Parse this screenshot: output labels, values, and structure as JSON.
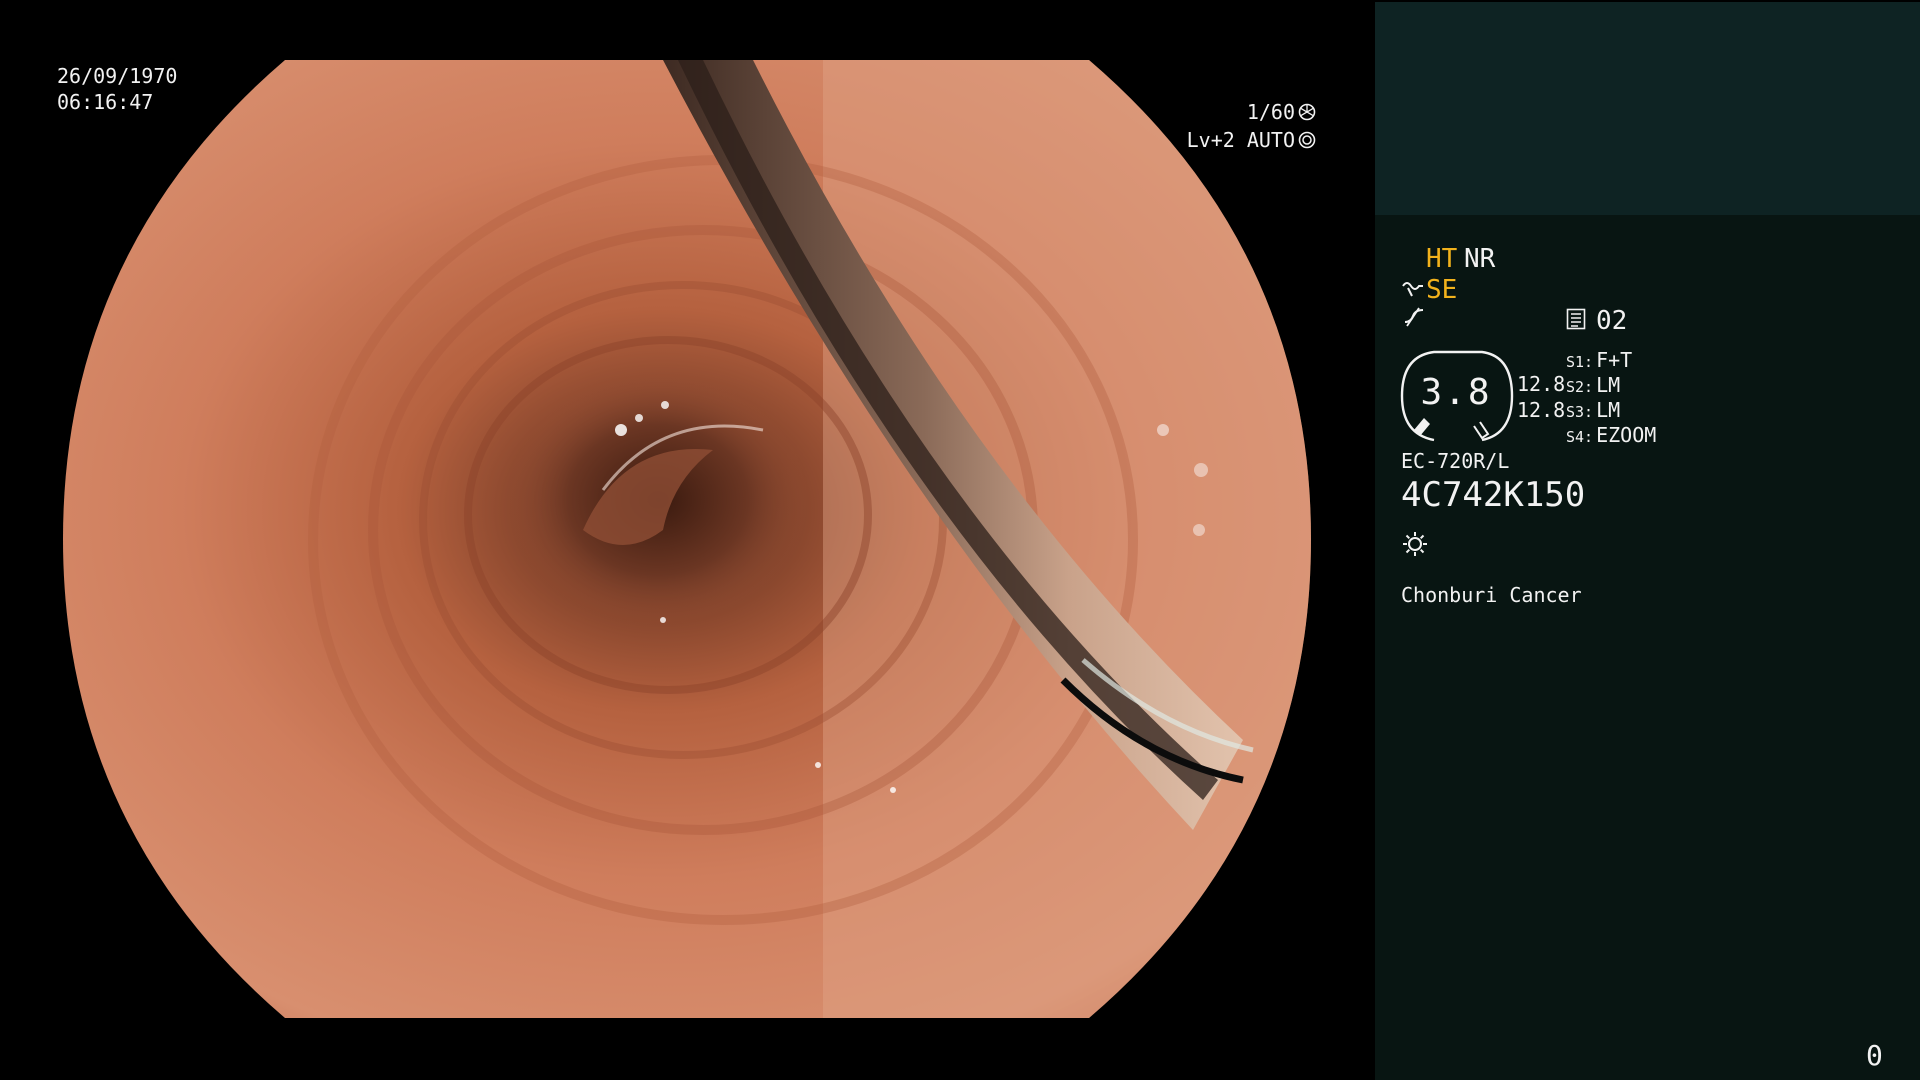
{
  "video": {
    "date": "26/09/1970",
    "time": "06:16:47",
    "shutter": "1/60",
    "iris": "Lv+2 AUTO",
    "shutter_icon": "shutter-icon",
    "iris_icon": "iris-icon"
  },
  "panel": {
    "modes": {
      "ht": "HT",
      "nr": "NR",
      "se": "SE",
      "se_icon": "structure-enhance-icon",
      "curve_icon": "tone-curve-icon"
    },
    "memory": {
      "icon": "memory-icon",
      "number": "02"
    },
    "zoom": {
      "value": "3.8",
      "ratio_top": "12.8",
      "ratio_bottom": "12.8"
    },
    "switches": [
      {
        "key": "S1:",
        "value": "F+T"
      },
      {
        "key": "S2:",
        "value": "LM"
      },
      {
        "key": "S3:",
        "value": "LM"
      },
      {
        "key": "S4:",
        "value": "EZOOM"
      }
    ],
    "scope_model": "EC-720R/L",
    "scope_serial": "4C742K150",
    "light_icon": "light-source-icon",
    "institution": "Chonburi Cancer",
    "counter": "0"
  },
  "colors": {
    "panel_top": "#0e2323",
    "panel_bg": "#081512",
    "accent_yellow": "#f2b21c",
    "text": "#f2f2f2",
    "mucosa": "#c97a5a"
  }
}
